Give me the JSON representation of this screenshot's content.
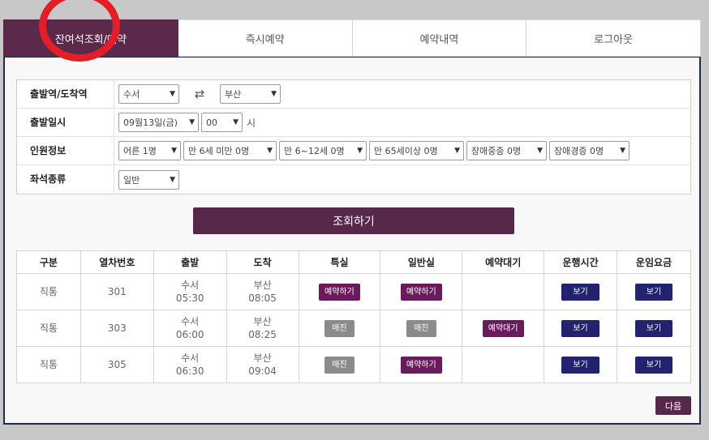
{
  "tabs": [
    {
      "label": "잔여석조회/예약",
      "active": true
    },
    {
      "label": "즉시예약"
    },
    {
      "label": "예약내역"
    },
    {
      "label": "로그아웃"
    }
  ],
  "form": {
    "station": {
      "label": "출발역/도착역",
      "from": "수서",
      "to": "부산",
      "swap_icon": "⇄"
    },
    "date": {
      "label": "출발일시",
      "day": "09월13일(금)",
      "hour": "00",
      "hour_unit": "시"
    },
    "passengers": {
      "label": "인원정보",
      "options": [
        "어른 1명",
        "만 6세 미만 0명",
        "만 6~12세 0명",
        "만 65세이상 0명",
        "장애중증 0명",
        "장애경증 0명"
      ]
    },
    "seat": {
      "label": "좌석종류",
      "value": "일반"
    }
  },
  "search_button": "조회하기",
  "results": {
    "headers": [
      "구분",
      "열차번호",
      "출발",
      "도착",
      "특실",
      "일반실",
      "예약대기",
      "운행시간",
      "운임요금"
    ],
    "rows": [
      {
        "type": "직통",
        "train": "301",
        "dep_station": "수서",
        "dep_time": "05:30",
        "arr_station": "부산",
        "arr_time": "08:05",
        "special": "예약하기",
        "general": "예약하기",
        "waitlist": "",
        "runtime": "보기",
        "fare": "보기"
      },
      {
        "type": "직통",
        "train": "303",
        "dep_station": "수서",
        "dep_time": "06:00",
        "arr_station": "부산",
        "arr_time": "08:25",
        "special": "매진",
        "general": "매진",
        "waitlist": "예약대기",
        "runtime": "보기",
        "fare": "보기"
      },
      {
        "type": "직통",
        "train": "305",
        "dep_station": "수서",
        "dep_time": "06:30",
        "arr_station": "부산",
        "arr_time": "09:04",
        "special": "매진",
        "general": "예약하기",
        "waitlist": "",
        "runtime": "보기",
        "fare": "보기"
      }
    ]
  },
  "next_button": "다음",
  "colors": {
    "accent": "#58284a",
    "reserve": "#6a1b5e",
    "soldout": "#8b8b8b",
    "view": "#22226e",
    "annotation": "#e21e26"
  }
}
